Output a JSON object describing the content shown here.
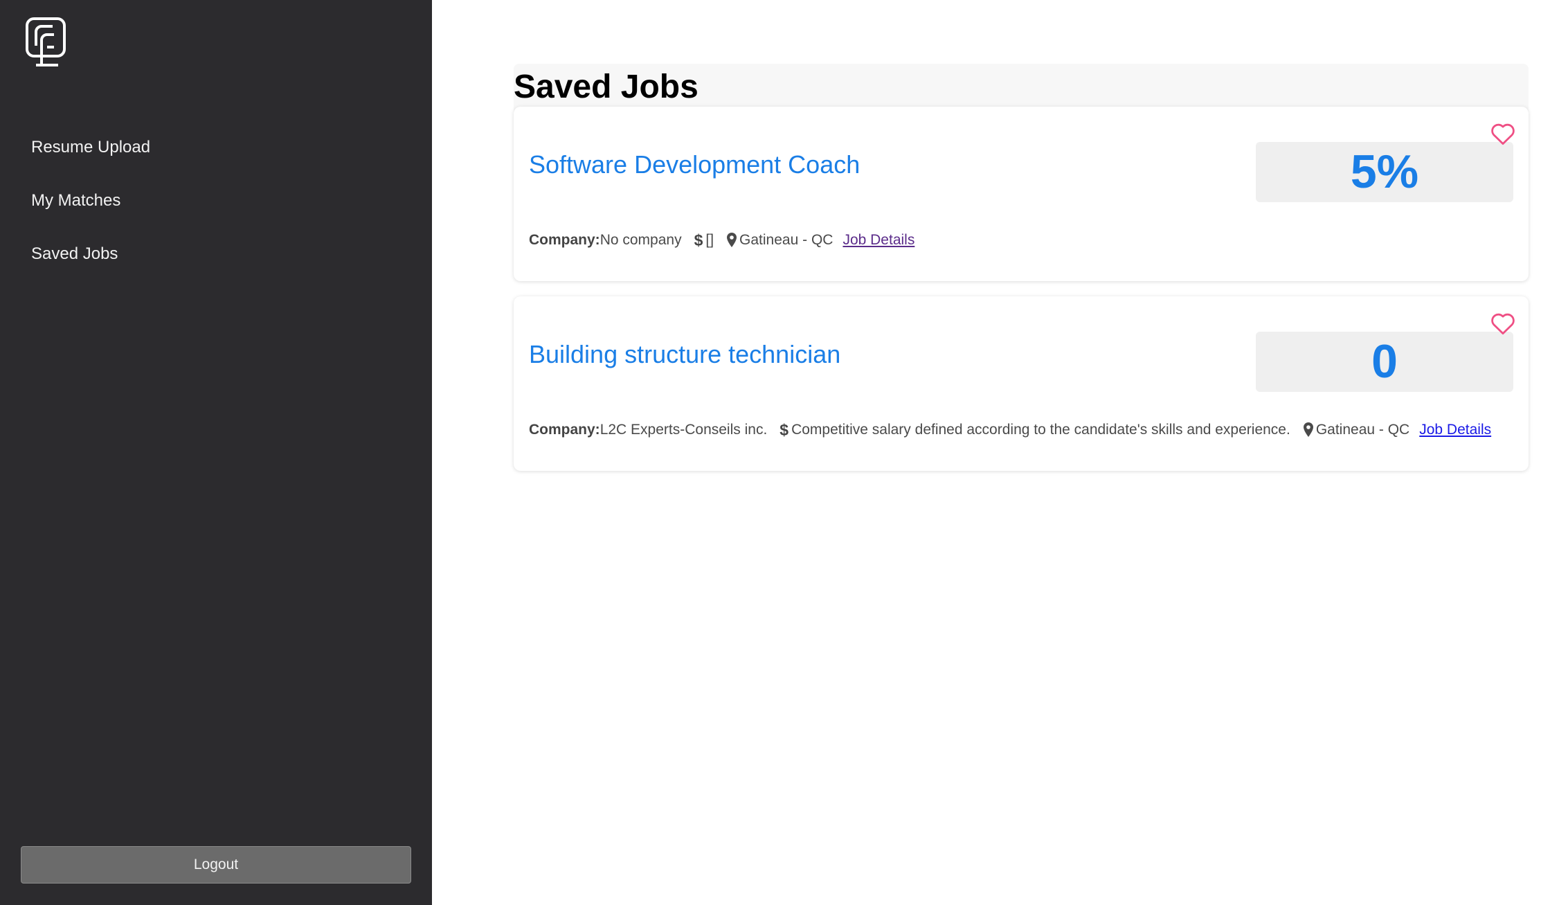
{
  "sidebar": {
    "nav": [
      {
        "label": "Resume Upload"
      },
      {
        "label": "My Matches"
      },
      {
        "label": "Saved Jobs"
      }
    ],
    "logout_label": "Logout"
  },
  "main": {
    "title": "Saved Jobs",
    "jobs": [
      {
        "title": "Software Development Coach",
        "score": "5%",
        "company_label": "Company:",
        "company": "No company",
        "salary": "[]",
        "location": "Gatineau - QC",
        "details_label": "Job Details"
      },
      {
        "title": "Building structure technician",
        "score": "0",
        "company_label": "Company:",
        "company": "L2C Experts-Conseils inc.",
        "salary": "Competitive salary defined according to the candidate's skills and experience.",
        "location": "Gatineau - QC",
        "details_label": "Job Details"
      }
    ]
  },
  "colors": {
    "sidebar_bg": "#2c2b2e",
    "accent_blue": "#1a7ee6",
    "heart_pink": "#ef4f84"
  },
  "icons": [
    "app-logo",
    "dollar-icon",
    "map-pin-icon",
    "heart-icon"
  ]
}
